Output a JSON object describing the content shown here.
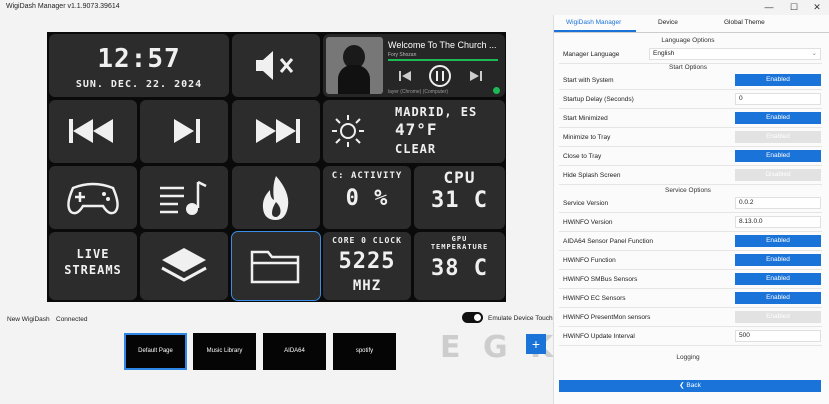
{
  "window": {
    "title": "WigiDash Manager v1.1.9073.39614",
    "minimize": "—",
    "maximize": "☐",
    "close": "✕"
  },
  "device": {
    "clock": {
      "time": "12:57",
      "date": "SUN. DEC. 22. 2024"
    },
    "media": {
      "song_title": "Welcome To The Church ...",
      "artist": "Fory Shozan",
      "source": "layer (Chrome) (Computer)"
    },
    "weather": {
      "city": "MADRID, ES",
      "temp": "47°F",
      "condition": "CLEAR"
    },
    "c_activity": {
      "label": "C: ACTIVITY",
      "value": "0 %"
    },
    "cpu": {
      "label": "CPU",
      "value": "31 C"
    },
    "live_streams": {
      "label": "LIVE\nSTREAMS"
    },
    "core_clock": {
      "label": "CORE 0 CLOCK",
      "value": "5225",
      "unit": "MHZ"
    },
    "gpu": {
      "label": "GPU\nTEMPERATURE",
      "value": "38 C"
    }
  },
  "footer": {
    "device_name": "New WigiDash",
    "status": "Connected",
    "emulate_label": "Emulate Device Touch",
    "add_label": "+"
  },
  "pages": [
    {
      "label": "Default Page"
    },
    {
      "label": "Music Library"
    },
    {
      "label": "AIDA64"
    },
    {
      "label": "spotify"
    }
  ],
  "watermark": "E G K N E T I C",
  "panel": {
    "tabs": [
      "WigiDash Manager",
      "Device",
      "Global Theme"
    ],
    "language_header": "Language Options",
    "manager_language_label": "Manager Language",
    "manager_language_value": "English",
    "start_header": "Start Options",
    "start_rows": [
      {
        "label": "Start with System",
        "value": "Enabled",
        "state": "on"
      },
      {
        "label": "Startup Delay (Seconds)",
        "value": "0",
        "state": "txt"
      },
      {
        "label": "Start Minimized",
        "value": "Enabled",
        "state": "on"
      },
      {
        "label": "Minimize to Tray",
        "value": "Enabled",
        "state": "off"
      },
      {
        "label": "Close to Tray",
        "value": "Enabled",
        "state": "on"
      },
      {
        "label": "Hide Splash Screen",
        "value": "Disabled",
        "state": "off"
      }
    ],
    "service_header": "Service Options",
    "service_rows": [
      {
        "label": "Service Version",
        "value": "0.0.2",
        "state": "txt"
      },
      {
        "label": "HWiNFO Version",
        "value": "8.13.0.0",
        "state": "txt"
      },
      {
        "label": "AIDA64 Sensor Panel Function",
        "value": "Enabled",
        "state": "on"
      },
      {
        "label": "HWiNFO Function",
        "value": "Enabled",
        "state": "on"
      },
      {
        "label": "HWiNFO SMBus Sensors",
        "value": "Enabled",
        "state": "on"
      },
      {
        "label": "HWiNFO EC Sensors",
        "value": "Enabled",
        "state": "on"
      },
      {
        "label": "HWiNFO PresentMon sensors",
        "value": "Enabled",
        "state": "off"
      },
      {
        "label": "HWiNFO Update Interval",
        "value": "500",
        "state": "txt"
      }
    ],
    "logging_header": "Logging",
    "back_label": "Back"
  },
  "colors": {
    "accent": "#1a73d9",
    "tile": "#2c2c2c",
    "disabled": "#e2e2e2"
  }
}
